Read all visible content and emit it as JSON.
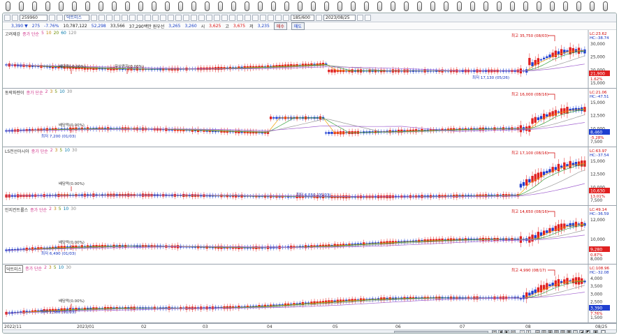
{
  "toolbar": {
    "code": "259960",
    "name": "덕트미스",
    "period_count": "185/600",
    "date": "2023/08/25"
  },
  "quote": {
    "price": "3,390 ▼",
    "change": "275",
    "rate": "-7.76%",
    "volume": "10,787,122",
    "v2": "52,298",
    "v3": "33,566",
    "amount": "37,290백만 원우선",
    "open": "3,265",
    "open2": "3,260",
    "high_label": "시",
    "high": "3,625",
    "high2_label": "고",
    "high2": "3,675",
    "low_label": "저",
    "low": "3,235",
    "buy_label": "매수",
    "sell_label": "매도"
  },
  "panes": [
    {
      "name": "고려제강",
      "indicator": "종가 단순",
      "periods": [
        "5",
        "10",
        "20",
        "60",
        "120"
      ],
      "axis": [
        "30,000",
        "25,000",
        "20,000",
        "15,000"
      ],
      "lc": "LC:23.62",
      "hc": "HC:-38.74",
      "price_tag": "21,900",
      "pct_tag": "1.62%",
      "annotations": [
        {
          "text": "최고 35,750 (08/03)",
          "kind": "high"
        },
        {
          "text": "최저 17,130 (05/26)",
          "kind": "low"
        },
        {
          "text": "배당락(-0.00%)",
          "kind": "event"
        },
        {
          "text": "무상증자(0.00%)",
          "kind": "event"
        }
      ]
    },
    {
      "name": "동락파렌이",
      "indicator": "종가 단순",
      "periods": [
        "2",
        "3",
        "5",
        "10",
        "30"
      ],
      "axis": [
        "15,000",
        "12,500",
        "10,000",
        "7,500"
      ],
      "lc": "LC:21.06",
      "hc": "HC:-47.51",
      "price_tag": "8,460",
      "pct_tag": "-5.28%",
      "annotations": [
        {
          "text": "최고 16,000 (08/16)",
          "kind": "high"
        },
        {
          "text": "배당락(0.00%)",
          "kind": "event"
        },
        {
          "text": "최저 7,200 (01/03)",
          "kind": "low"
        }
      ]
    },
    {
      "name": "LS전선아시아",
      "indicator": "종가 단순",
      "periods": [
        "2",
        "3",
        "5",
        "10",
        "30"
      ],
      "axis": [
        "15,000",
        "12,500",
        "10,000",
        "7,500"
      ],
      "lc": "LC:63.97",
      "hc": "HC:-37.54",
      "price_tag": "10,630",
      "pct_tag": "13.01%",
      "annotations": [
        {
          "text": "최고 17,100 (08/16)",
          "kind": "high"
        },
        {
          "text": "배당락(0.00%)",
          "kind": "event"
        },
        {
          "text": "최저 6,550 (05/03)",
          "kind": "low"
        }
      ]
    },
    {
      "name": "인지컨트롤스",
      "indicator": "종가 단순",
      "periods": [
        "2",
        "3",
        "5",
        "10",
        "30"
      ],
      "axis": [
        "12,000",
        "10,000",
        "8,000"
      ],
      "lc": "LC:49.14",
      "hc": "HC:-36.59",
      "price_tag": "9,280",
      "pct_tag": "0.87%",
      "annotations": [
        {
          "text": "최고 14,650 (08/16)",
          "kind": "high"
        },
        {
          "text": "배당락(0.00%)",
          "kind": "event"
        },
        {
          "text": "최저 6,490 (01/03)",
          "kind": "low"
        }
      ]
    },
    {
      "name": "덕트미스",
      "indicator": "종가 단순",
      "periods": [
        "2",
        "3",
        "5",
        "10",
        "30"
      ],
      "axis": [
        "4,000",
        "3,500",
        "3,000",
        "2,500",
        "2,000",
        "1,500"
      ],
      "lc": "LC:108.96",
      "hc": "HC:-32.08",
      "price_tag": "3,390",
      "pct_tag": "7.76%",
      "annotations": [
        {
          "text": "최고 4,990 (08/17)",
          "kind": "high"
        },
        {
          "text": "배당락(0.00%)",
          "kind": "event"
        },
        {
          "text": "최저 1,588 (01/03)",
          "kind": "low"
        }
      ]
    }
  ],
  "xaxis": [
    "2022/11",
    "2023/01",
    "02",
    "03",
    "04",
    "05",
    "06",
    "07",
    "08",
    "08/25"
  ],
  "colors": {
    "up": "#e02020",
    "down": "#1f3fd0",
    "ma1": "#f0a000",
    "ma2": "#3aa040",
    "ma3": "#9a9a9a",
    "ma4": "#a060d0",
    "high": "#d00000",
    "low": "#1030c0"
  }
}
